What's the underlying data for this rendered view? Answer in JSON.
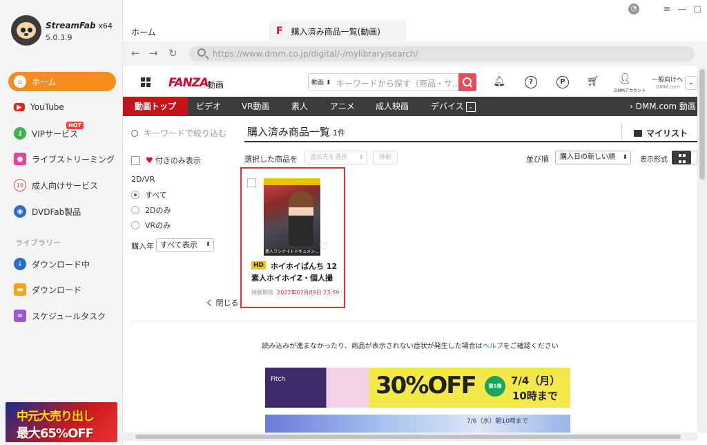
{
  "app": {
    "name": "StreamFab",
    "arch": "x64",
    "version": "5.0.3.9"
  },
  "sidebar": {
    "items": [
      {
        "label": "ホーム",
        "icon": "home-icon",
        "color": "#f68c1e"
      },
      {
        "label": "YouTube",
        "icon": "youtube-icon",
        "color": "#e62117"
      },
      {
        "label": "VIPサービス",
        "icon": "key-icon",
        "color": "#3cb44b",
        "badge": "HOT"
      },
      {
        "label": "ライブストリーミング",
        "icon": "camera-icon",
        "color": "#e4459a"
      },
      {
        "label": "成人向けサービス",
        "icon": "adult-icon",
        "color": "#e8423a"
      },
      {
        "label": "DVDFab製品",
        "icon": "dvdfab-icon",
        "color": "#2a6cd2"
      }
    ],
    "library_label": "ライブラリー",
    "library_items": [
      {
        "label": "ダウンロード中",
        "icon": "download-icon",
        "color": "#2a6cd2"
      },
      {
        "label": "ダウンロード",
        "icon": "folder-icon",
        "color": "#f6a31e"
      },
      {
        "label": "スケジュールタスク",
        "icon": "schedule-icon",
        "color": "#9b59d0"
      }
    ],
    "promo": {
      "line1": "中元大売り出し",
      "line2": "最大65%OFF"
    }
  },
  "tabs": {
    "home": "ホーム",
    "active": "購入済み商品一覧(動画)",
    "active_icon": "F"
  },
  "address_bar": {
    "url": "https://www.dmm.co.jp/digital/-/mylibrary/search/"
  },
  "dmm": {
    "brand": "FANZA",
    "brand_sub": "動画",
    "search_category": "動画 ⬍",
    "search_placeholder": "キーワードから探す（商品・サ…",
    "account_label": "DMMアカウント",
    "ippan_line1": "一般向けへ",
    "ippan_line2": "DMM.com",
    "categories": [
      "動画トップ",
      "ビデオ",
      "VR動画",
      "素人",
      "アニメ",
      "成人映画",
      "デバイス"
    ],
    "right_link": "› DMM.com 動画",
    "filter": {
      "keyword_placeholder": "キーワードで絞り込む",
      "heart_only": "付きのみ表示",
      "type_label": "2D/VR",
      "type_options": [
        "すべて",
        "2Dのみ",
        "VRのみ"
      ],
      "type_selected": 0,
      "year_label": "購入年",
      "year_value": "すべて表示",
      "close": "く 閉じる"
    },
    "list": {
      "title": "購入済み商品一覧",
      "count": "1件",
      "mylist": "マイリスト",
      "selected_label": "選択した商品を",
      "add_to": "追加先を選択",
      "move": "移動",
      "sort_label": "並び順",
      "sort_value": "購入日の新しい順",
      "view_label": "表示形式"
    },
    "product": {
      "badge": "HD",
      "title_line1": "ホイホイぱんち 12",
      "title_line2": "素人ホイホイZ・個人撮",
      "meta_label": "視聴期限",
      "date": "2022年07月09日 23:59",
      "cover_caption": "素人ワンナイトドキュメン..."
    },
    "help_prefix": "読み込みが進まなかったり、商品が表示されない症状が発生した場合は",
    "help_link": "ヘルプ",
    "help_suffix": "をご確認ください",
    "banner1": {
      "side": "Fitch",
      "main": "30%OFF",
      "badge": "第1弾",
      "date1": "7/4（月）",
      "date2": "10時まで"
    },
    "banner2": {
      "text": "7/6（水）朝10時まで"
    }
  }
}
